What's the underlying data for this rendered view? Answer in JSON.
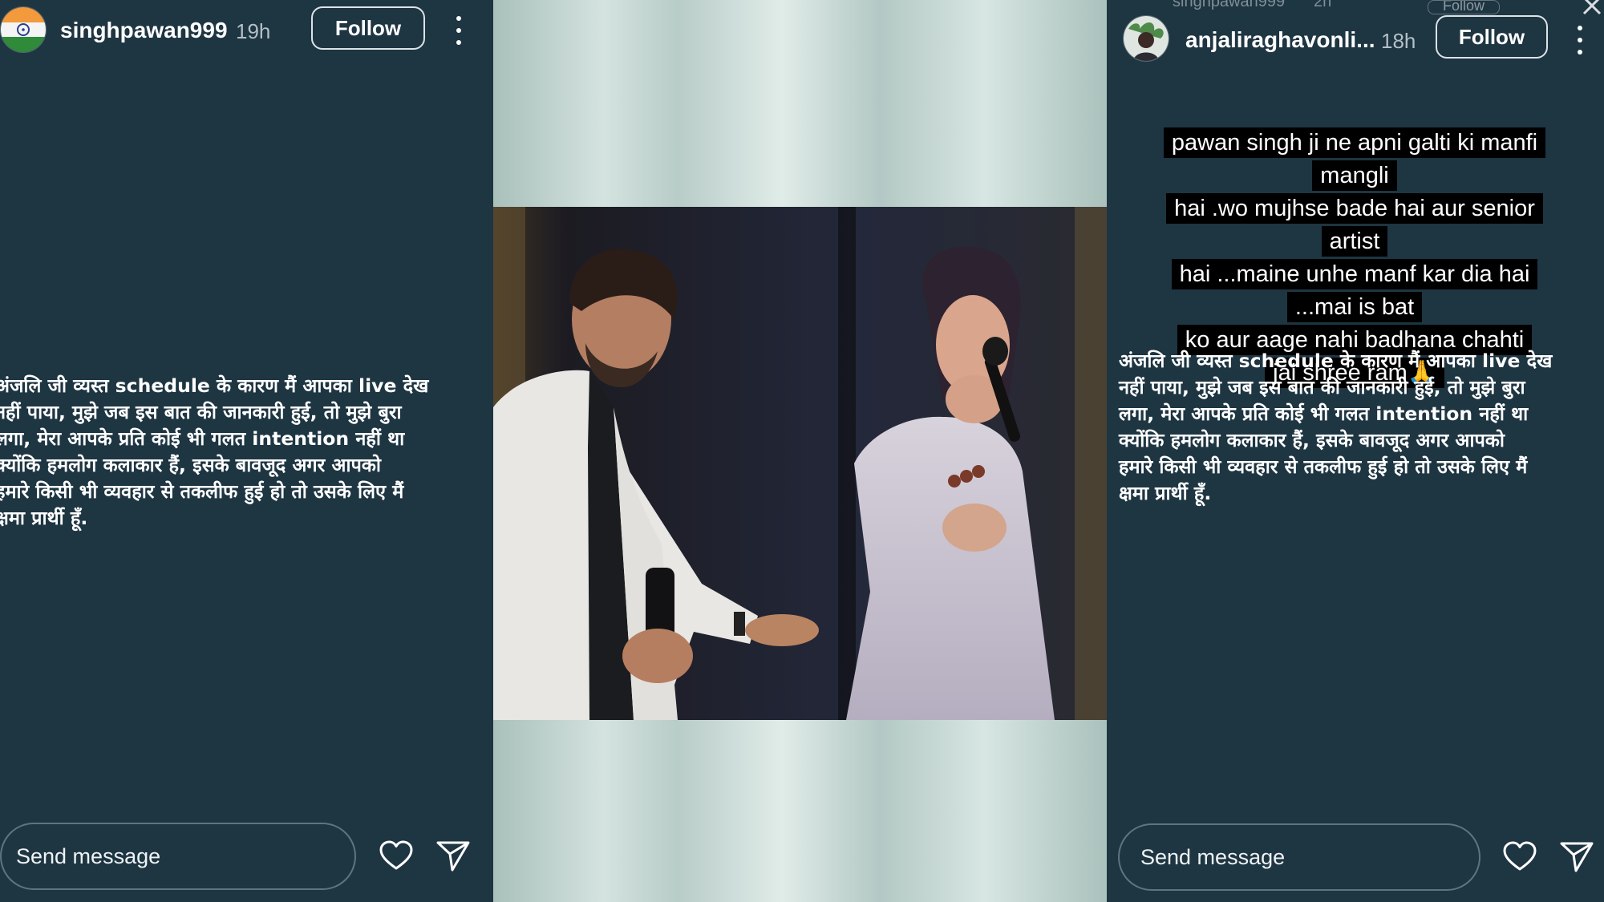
{
  "colors": {
    "story_background": "#1e3542",
    "text": "#ffffff",
    "caption_background": "#000000",
    "follow_border": "#dbe3e6"
  },
  "left_story": {
    "username": "singhpawan999",
    "time": "19h",
    "follow_label": "Follow",
    "avatar_icon": "india-flag-avatar",
    "message": "अंजलि जी व्यस्त schedule के कारण मैं आपका live देख\nनहीं पाया,  मुझे जब इस बात की जानकारी हुई,  तो मुझे बुरा\nलगा,  मेरा आपके प्रति कोई भी गलत intention नहीं था\nक्योंकि हमलोग कलाकार हैं,  इसके बावजूद अगर आपको\nहमारे  किसी भी व्यवहार से तकलीफ हुई हो तो उसके लिए मैं\nक्षमा प्रार्थी हूँ.",
    "send_placeholder": "Send message",
    "icons": [
      "heart-icon",
      "send-icon",
      "more-icon"
    ]
  },
  "middle": {
    "image": "stage-photo-man-in-white-jacket-and-woman-with-microphone"
  },
  "right_story": {
    "previous_username": "singhpawan999",
    "previous_time": "2h",
    "previous_follow_label": "Follow",
    "username": "anjaliraghavonli...",
    "time": "18h",
    "follow_label": "Follow",
    "avatar_icon": "profile-photo-avatar",
    "caption": "pawan singh ji ne apni galti ki manfi mangli\nhai .wo mujhse bade hai aur senior artist\nhai ...maine unhe manf kar dia hai ...mai is bat\nko aur aage nahi badhana chahti\njai shree ram🙏",
    "message": "अंजलि जी व्यस्त schedule के कारण मैं आपका live देख\nनहीं पाया,  मुझे जब इस बात की जानकारी हुई,  तो मुझे बुरा\nलगा,  मेरा आपके प्रति कोई भी गलत intention नहीं था\nक्योंकि हमलोग कलाकार हैं,  इसके बावजूद अगर आपको\nहमारे  किसी भी व्यवहार से तकलीफ हुई हो तो उसके लिए मैं\nक्षमा प्रार्थी हूँ.",
    "send_placeholder": "Send message",
    "icons": [
      "heart-icon",
      "send-icon",
      "more-icon",
      "close-icon"
    ]
  }
}
